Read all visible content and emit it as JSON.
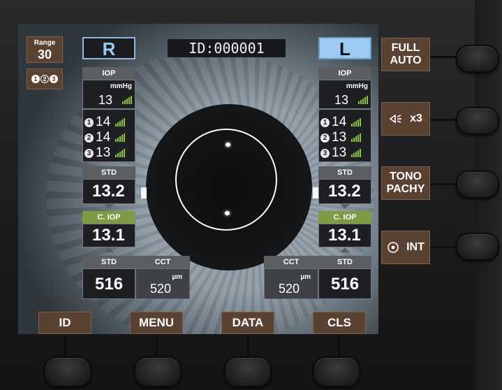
{
  "range": {
    "label": "Range",
    "value": "30"
  },
  "sequence": {
    "items": [
      "1",
      "2",
      "3"
    ]
  },
  "eyes": {
    "right_label": "R",
    "left_label": "L"
  },
  "patient_id": "ID:000001",
  "right": {
    "iop_header": "IOP",
    "iop_unit": "mmHg",
    "iop_value": "13",
    "measurements": [
      {
        "n": "1",
        "value": "14"
      },
      {
        "n": "2",
        "value": "14"
      },
      {
        "n": "3",
        "value": "13"
      }
    ],
    "std_header": "STD",
    "std_value": "13.2",
    "ciop_header": "C. IOP",
    "ciop_value": "13.1",
    "pachy_std_header": "STD",
    "pachy_std_value": "516",
    "cct_header": "CCT",
    "cct_unit": "µm",
    "cct_value": "520"
  },
  "left": {
    "iop_header": "IOP",
    "iop_unit": "mmHg",
    "iop_value": "13",
    "measurements": [
      {
        "n": "1",
        "value": "14"
      },
      {
        "n": "2",
        "value": "13"
      },
      {
        "n": "3",
        "value": "13"
      }
    ],
    "std_header": "STD",
    "std_value": "13.2",
    "ciop_header": "C. IOP",
    "ciop_value": "13.1",
    "pachy_std_header": "STD",
    "pachy_std_value": "516",
    "cct_header": "CCT",
    "cct_unit": "µm",
    "cct_value": "520"
  },
  "side_buttons": {
    "full_auto_1": "FULL",
    "full_auto_2": "AUTO",
    "puff_label": "x3",
    "puff_icon": "speaker-puff-icon",
    "tono_1": "TONO",
    "tono_2": "PACHY",
    "int_icon": "target-icon",
    "int_label": "INT"
  },
  "bottom_buttons": {
    "id": "ID",
    "menu": "MENU",
    "data": "DATA",
    "cls": "CLS"
  },
  "colors": {
    "button_brown": "#5a4232",
    "signal_green": "#8fc33b",
    "ciop_green": "#7d9b45",
    "eye_blue": "#9ccaf0"
  }
}
